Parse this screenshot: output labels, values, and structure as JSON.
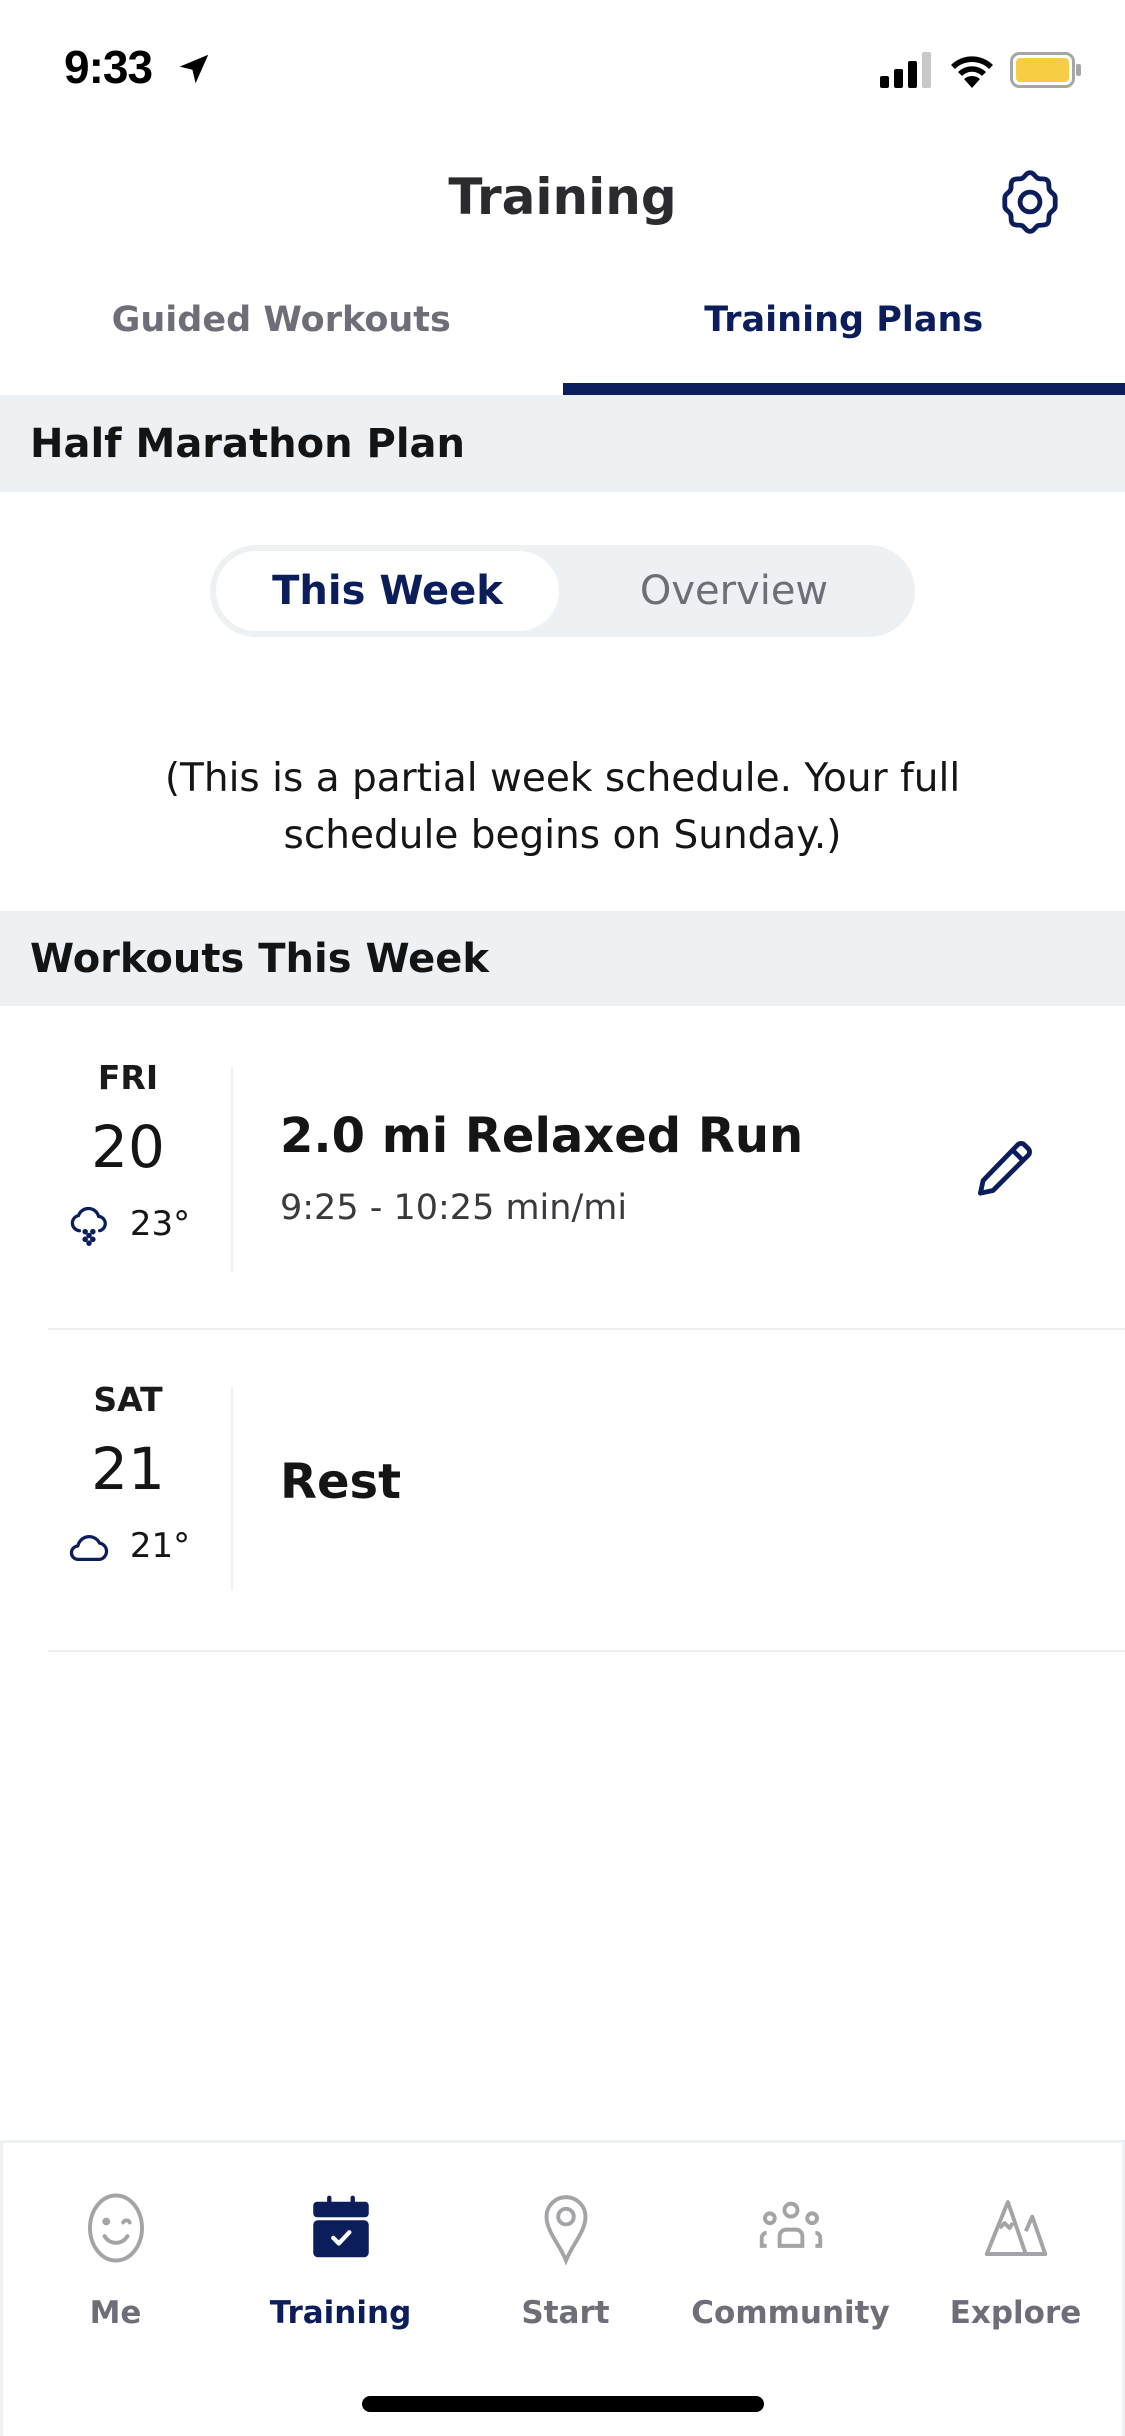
{
  "status_bar": {
    "time": "9:33",
    "icons": [
      "location-arrow-icon",
      "cellular-signal-icon",
      "wifi-icon",
      "battery-icon"
    ]
  },
  "header": {
    "title": "Training",
    "settings_icon": "gear-icon"
  },
  "tabs": [
    {
      "label": "Guided Workouts",
      "active": false
    },
    {
      "label": "Training Plans",
      "active": true
    }
  ],
  "plan": {
    "title": "Half Marathon Plan",
    "segments": [
      {
        "label": "This Week",
        "active": true
      },
      {
        "label": "Overview",
        "active": false
      }
    ],
    "note_line1": "(This is a partial week schedule. Your full",
    "note_line2": "schedule begins on Sunday.)"
  },
  "workouts": {
    "section_title": "Workouts This Week",
    "items": [
      {
        "day": "FRI",
        "date": "20",
        "weather_icon": "cloud-snow-icon",
        "temperature": "23°",
        "title": "2.0 mi Relaxed Run",
        "subtitle": "9:25 - 10:25 min/mi",
        "action_icon": "pencil-icon"
      },
      {
        "day": "SAT",
        "date": "21",
        "weather_icon": "cloud-icon",
        "temperature": "21°",
        "title": "Rest"
      }
    ]
  },
  "bottom_nav": {
    "items": [
      {
        "label": "Me",
        "icon": "smiley-wink-icon",
        "active": false
      },
      {
        "label": "Training",
        "icon": "calendar-check-icon",
        "active": true
      },
      {
        "label": "Start",
        "icon": "map-pin-icon",
        "active": false
      },
      {
        "label": "Community",
        "icon": "people-group-icon",
        "active": false
      },
      {
        "label": "Explore",
        "icon": "mountain-icon",
        "active": false
      }
    ]
  },
  "colors": {
    "accent": "#0b1d5a",
    "inactive_text": "#6e6e78",
    "section_bg": "#eef1f4",
    "battery": "#f7cd46",
    "nav_icon_inactive": "#a4a4a8"
  }
}
